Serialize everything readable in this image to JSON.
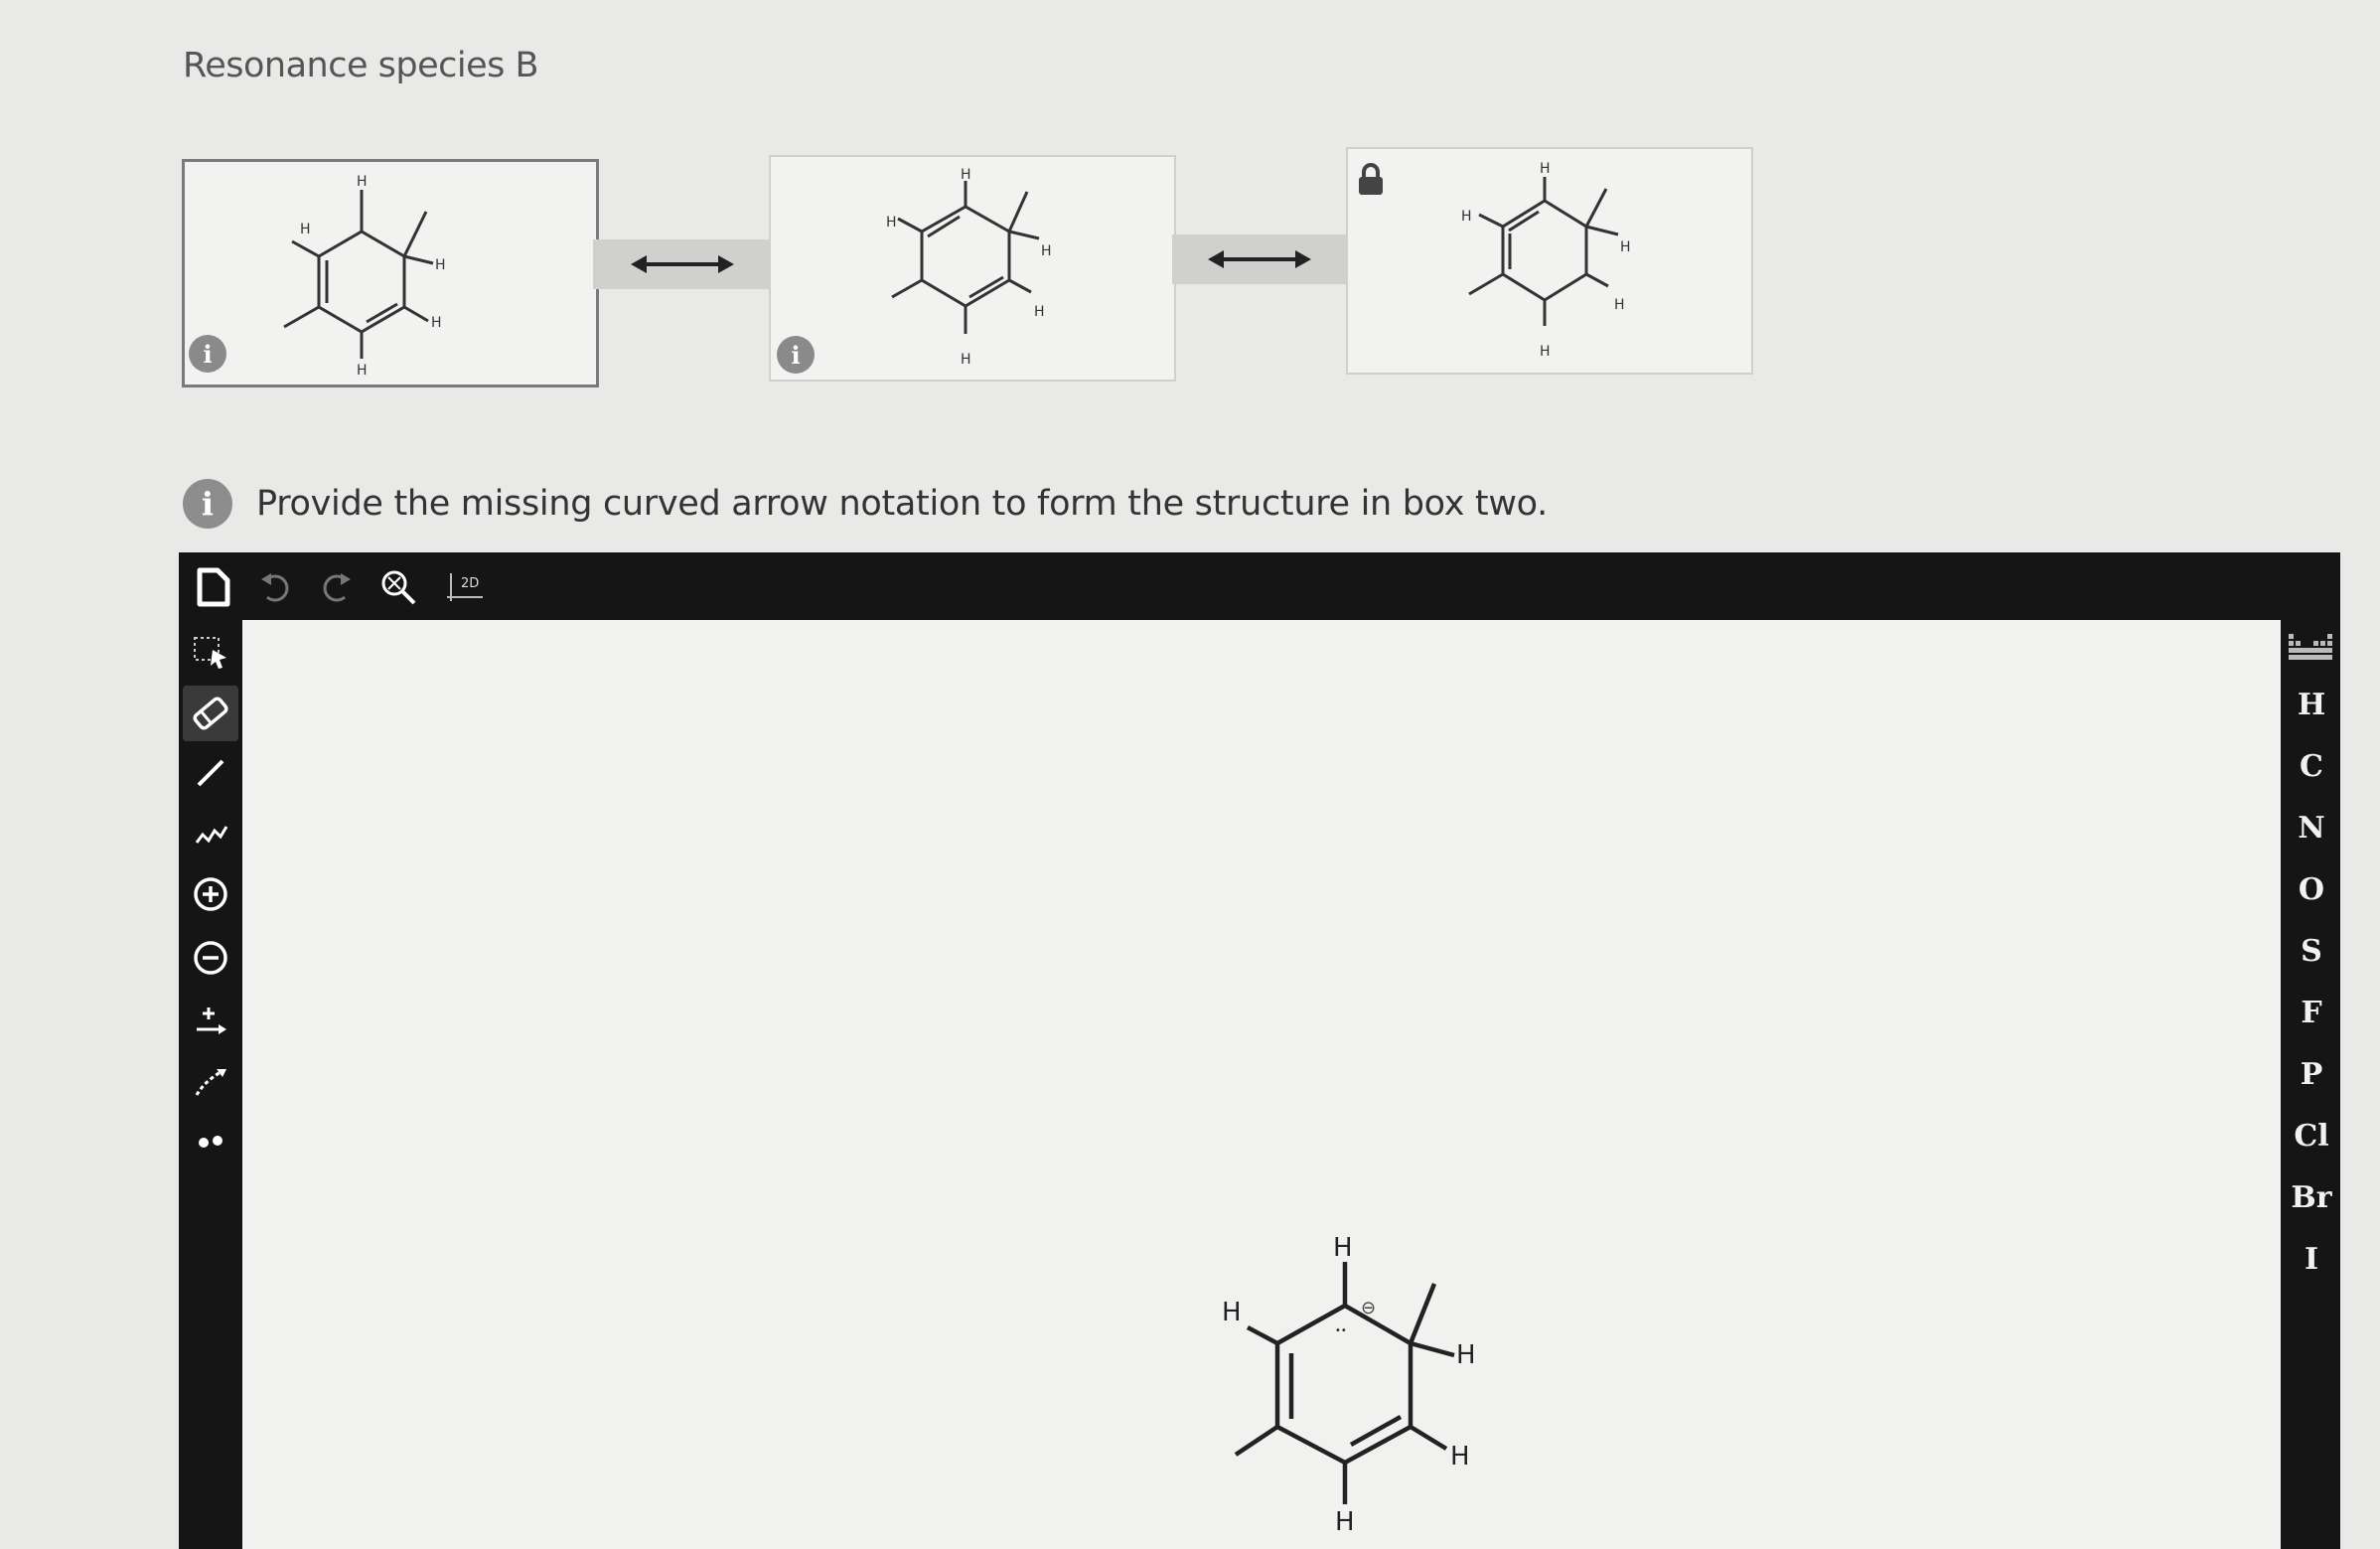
{
  "section_title": "Resonance species B",
  "prompt": {
    "text": "Provide the missing curved arrow notation to form the structure in box two."
  },
  "structure_labels": {
    "h": "H",
    "h_left": "H",
    "charge": "⊖",
    "lone_pair": "••"
  },
  "toolbar": {
    "new_icon": "document-icon",
    "undo_icon": "undo-icon",
    "redo_icon": "redo-icon",
    "zoom_icon": "zoom-icon",
    "clean2d_label": "2D"
  },
  "left_tools": [
    "selection-tool",
    "eraser-tool",
    "bond-tool",
    "chain-tool",
    "positive-charge-tool",
    "negative-charge-tool",
    "curved-arrow-tool",
    "electron-flow-tool",
    "lone-pair-tool"
  ],
  "elements": [
    "H",
    "C",
    "N",
    "O",
    "S",
    "F",
    "P",
    "Cl",
    "Br",
    "I"
  ],
  "colors": {
    "editor_dark": "#151515",
    "canvas_bg": "#f1f1ef",
    "page_bg": "#e9e9e7"
  }
}
